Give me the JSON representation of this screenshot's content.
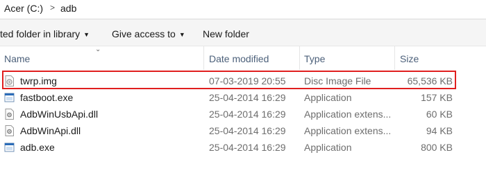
{
  "address": {
    "drive": "Acer (C:)",
    "separator": ">",
    "folder": "adb"
  },
  "toolbar": {
    "include_in_library": "ted folder in library",
    "give_access": "Give access to",
    "new_folder": "New folder"
  },
  "columns": {
    "name": "Name",
    "date_modified": "Date modified",
    "type": "Type",
    "size": "Size"
  },
  "files": [
    {
      "name": "twrp.img",
      "date": "07-03-2019 20:55",
      "type": "Disc Image File",
      "size": "65,536 KB",
      "icon": "disc-image-file-icon"
    },
    {
      "name": "fastboot.exe",
      "date": "25-04-2014 16:29",
      "type": "Application",
      "size": "157 KB",
      "icon": "application-icon"
    },
    {
      "name": "AdbWinUsbApi.dll",
      "date": "25-04-2014 16:29",
      "type": "Application extens...",
      "size": "60 KB",
      "icon": "dll-file-icon"
    },
    {
      "name": "AdbWinApi.dll",
      "date": "25-04-2014 16:29",
      "type": "Application extens...",
      "size": "94 KB",
      "icon": "dll-file-icon"
    },
    {
      "name": "adb.exe",
      "date": "25-04-2014 16:29",
      "type": "Application",
      "size": "800 KB",
      "icon": "application-icon"
    }
  ],
  "colors": {
    "highlight_border": "#e01e1e",
    "header_text": "#4c607a",
    "toolbar_bg": "#f5f5f5"
  }
}
